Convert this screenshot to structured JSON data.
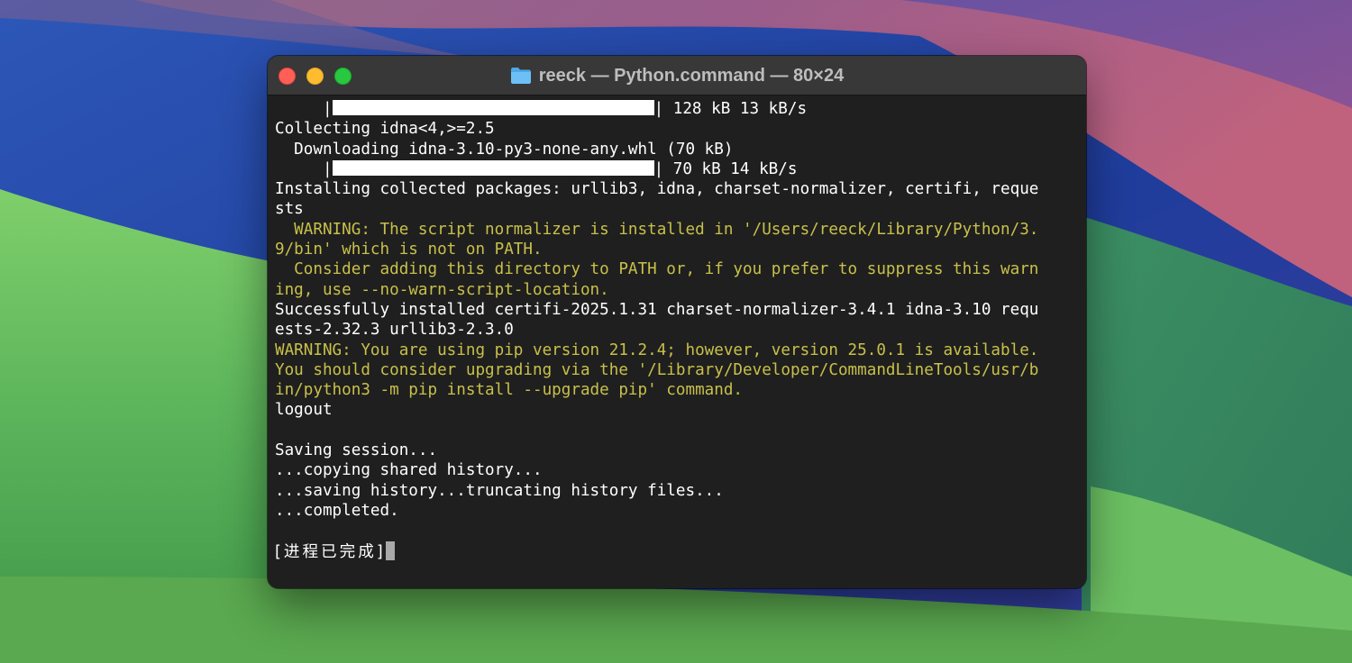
{
  "window": {
    "title": "reeck — Python.command — 80×24",
    "buttons": [
      "close",
      "minimize",
      "zoom"
    ]
  },
  "terminal": {
    "colors": {
      "text": "#ffffff",
      "warning": "#c8c04a",
      "background": "#1f1f1f"
    },
    "lines": [
      {
        "prefix": "     |",
        "bar": true,
        "suffix": "| 128 kB 13 kB/s"
      },
      {
        "text": "Collecting idna<4,>=2.5"
      },
      {
        "text": "  Downloading idna-3.10-py3-none-any.whl (70 kB)"
      },
      {
        "prefix": "     |",
        "bar": true,
        "suffix": "| 70 kB 14 kB/s"
      },
      {
        "text": "Installing collected packages: urllib3, idna, charset-normalizer, certifi, reque"
      },
      {
        "text": "sts"
      },
      {
        "text": "  WARNING: The script normalizer is installed in '/Users/reeck/Library/Python/3.",
        "warn": true
      },
      {
        "text": "9/bin' which is not on PATH.",
        "warn": true
      },
      {
        "text": "  Consider adding this directory to PATH or, if you prefer to suppress this warn",
        "warn": true
      },
      {
        "text": "ing, use --no-warn-script-location.",
        "warn": true
      },
      {
        "text": "Successfully installed certifi-2025.1.31 charset-normalizer-3.4.1 idna-3.10 requ"
      },
      {
        "text": "ests-2.32.3 urllib3-2.3.0"
      },
      {
        "text": "WARNING: You are using pip version 21.2.4; however, version 25.0.1 is available.",
        "warn": true
      },
      {
        "text": "You should consider upgrading via the '/Library/Developer/CommandLineTools/usr/b",
        "warn": true
      },
      {
        "text": "in/python3 -m pip install --upgrade pip' command.",
        "warn": true
      },
      {
        "text": "logout"
      },
      {
        "text": ""
      },
      {
        "text": "Saving session..."
      },
      {
        "text": "...copying shared history..."
      },
      {
        "text": "...saving history...truncating history files..."
      },
      {
        "text": "...completed."
      },
      {
        "text": ""
      },
      {
        "text": "[进程已完成]",
        "cursor": true
      }
    ]
  }
}
